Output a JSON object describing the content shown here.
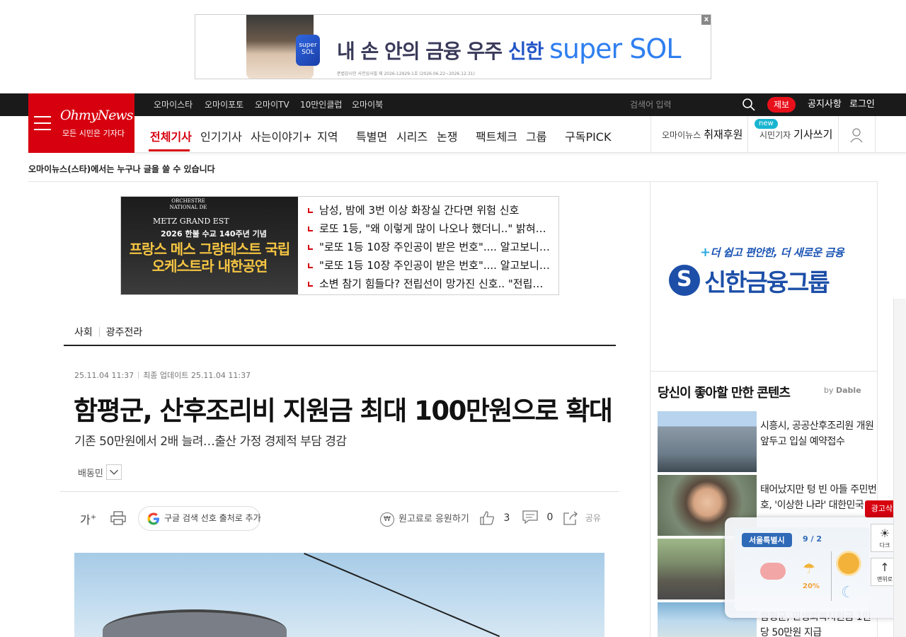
{
  "top_ad": {
    "headline": "내 손 안의 금융 우주",
    "brand_ko": "신한",
    "brand_en": "super SOL",
    "phone_label": "super SOL",
    "fine_print": "준법감시인 사전심사필 제 2026-12929-1호 (2026.06.22~2026.12.31)",
    "close": "x"
  },
  "topbar": {
    "services": [
      "오마이스타",
      "오마이포토",
      "오마이TV",
      "10만인클럽",
      "오마이북"
    ],
    "search_placeholder": "검색어 입력",
    "tip_button": "제보",
    "notice": "공지사항",
    "login": "로그인"
  },
  "logo": {
    "name": "OhmyNews",
    "slogan": "모든 시민은 기자다"
  },
  "nav": {
    "items": [
      "전체기사",
      "인기기사",
      "사는이야기+",
      "지역",
      "특별면",
      "시리즈",
      "논쟁",
      "팩트체크",
      "그룹",
      "구독PICK"
    ],
    "sponsor_small": "오마이뉴스",
    "sponsor_label": "취재후원",
    "write_small": "시민기자",
    "write_label": "기사쓰기",
    "new_badge": "new"
  },
  "tagline": "오마이뉴스(스타)에서는 누구나 글을 쓸 수 있습니다",
  "promo": {
    "orchestra": "ORCHESTRE NATIONAL DE",
    "metz": "METZ GRAND EST",
    "sub": "2026 한불 수교 140주년 기념",
    "big": "프랑스 메스 그랑테스트 국립 오케스트라 내한공연",
    "links": [
      "남성, 밤에 3번 이상 화장실 간다면 위험 신호",
      "로또 1등, \"왜 이렇게 많이 나오나 했더니..\" 밝혀…",
      "\"로또 1등 10장 주인공이 받은 번호\".... 알고보니 …",
      "\"로또 1등 10장 주인공이 받은 번호\".... 알고보니 …",
      "소변 참기 힘들다? 전립선이 망가진 신호.. \"전립…"
    ]
  },
  "article": {
    "breadcrumb": [
      "사회",
      "광주전라"
    ],
    "published": "25.11.04 11:37",
    "updated_label": "최종 업데이트",
    "updated": "25.11.04 11:37",
    "title": "함평군, 산후조리비 지원금 최대 100만원으로 확대",
    "subtitle": "기존 50만원에서 2배 늘려…출산 가정 경제적 부담 경감",
    "author": "배동민",
    "font_button": "가",
    "google_button": "구글 검색 선호 출처로 추가",
    "support": "원고료로 응원하기",
    "likes": "3",
    "comments": "0",
    "share": "공유"
  },
  "right_ad": {
    "tagline": "더 쉽고 편안한, 더 새로운 금융",
    "name": "신한금융그룹"
  },
  "recommend": {
    "title": "당신이 좋아할 만한 콘텐츠",
    "by": "by",
    "provider": "Dable",
    "items": [
      "시흥시, 공공산후조리원 개원 앞두고 입실 예약접수",
      "태어났지만 텅 빈 아들 주민번호, '이상한 나라' 대한민국",
      "",
      "함평군, 민생회복지원금 1인당 50만원 지급"
    ]
  },
  "weather": {
    "city": "서울특별시",
    "date": "9 / 2",
    "rain_pct": "20%",
    "remove_ad": "광고삭제",
    "dark_label": "다크",
    "top_label": "맨위로"
  },
  "colors": {
    "brand_red": "#d7000f",
    "topbar_bg": "#1a1a1a",
    "bank_blue": "#1d4fa8"
  }
}
